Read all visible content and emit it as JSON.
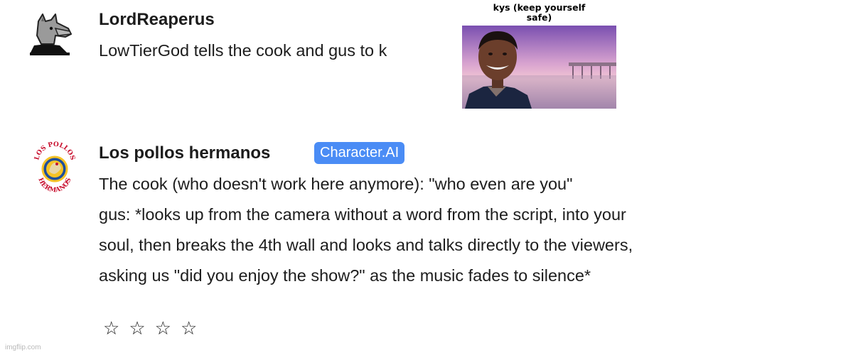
{
  "messages": [
    {
      "author": "LordReaperus",
      "lines": [
        "LowTierGod tells the cook and gus to k"
      ]
    },
    {
      "author": "Los pollos hermanos",
      "badge": "Character.AI",
      "lines": [
        "The cook (who doesn't work here anymore): \"who even are you\"",
        "gus: *looks up from the camera without a word from the script, into your",
        "soul, then breaks the 4th wall and looks and talks directly to the viewers,",
        "asking us \"did you enjoy the show?\" as the music fades to silence*"
      ],
      "logo_text": [
        "LOS POLLOS",
        "HERMANOS"
      ]
    }
  ],
  "meme": {
    "caption_line1": "kys (keep yourself",
    "caption_line2": "safe)"
  },
  "rating": {
    "stars": [
      "☆",
      "☆",
      "☆",
      "☆"
    ],
    "filled": 0,
    "max": 4
  },
  "watermark": "imgflip.com",
  "colors": {
    "badge": "#4a8cf5",
    "text": "#1d1d1d",
    "logo_red": "#c8102e",
    "logo_blue": "#1e4f9c",
    "logo_yellow": "#f6c326"
  }
}
